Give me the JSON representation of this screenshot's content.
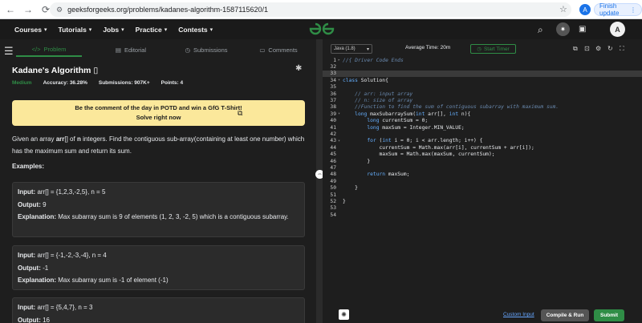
{
  "browser": {
    "url": "geeksforgeeks.org/problems/kadanes-algorithm-1587115620/1",
    "profile_letter": "A",
    "update_label": "Finish update"
  },
  "header": {
    "nav": [
      "Courses",
      "Tutorials",
      "Jobs",
      "Practice",
      "Contests"
    ],
    "logo": "GG",
    "user_letter": "A"
  },
  "tabs": [
    "Problem",
    "Editorial",
    "Submissions",
    "Comments"
  ],
  "problem": {
    "title": "Kadane's Algorithm",
    "difficulty": "Medium",
    "accuracy_label": "Accuracy:",
    "accuracy": "36.28%",
    "submissions_label": "Submissions:",
    "submissions": "907K+",
    "points_label": "Points:",
    "points": "4",
    "potd_line1": "Be the comment of the day in POTD and win a GfG T-Shirt!",
    "potd_line2": "Solve right now",
    "description_pre": "Given an array ",
    "description_arr": "arr",
    "description_mid": "[] of ",
    "description_n": "n",
    "description_post": " integers. Find the contiguous sub-array(containing at least one number) which has the maximum sum and return its sum.",
    "examples_heading": "Examples:",
    "examples": [
      {
        "input": "arr[] = {1,2,3,-2,5}, n = 5",
        "output": "9",
        "explanation": "Max subarray sum is 9 of elements (1, 2, 3, -2, 5) which is a contiguous subarray."
      },
      {
        "input": "arr[] = {-1,-2,-3,-4}, n = 4",
        "output": "-1",
        "explanation": "Max subarray sum is -1 of element (-1)"
      },
      {
        "input": "arr[] = {5,4,7}, n = 3",
        "output": "16"
      }
    ],
    "labels": {
      "input": "Input:",
      "output": "Output:",
      "explanation": "Explanation:"
    }
  },
  "editor": {
    "language": "Java (1.8)",
    "avg_time": "Average Time: 20m",
    "start_timer": "Start Timer",
    "lines": [
      {
        "n": "1",
        "t": "//{ Driver Code Ends",
        "c": "cm",
        "fold": "+"
      },
      {
        "n": "32",
        "t": ""
      },
      {
        "n": "33",
        "t": "",
        "hl": true
      },
      {
        "n": "34",
        "t": "class Solution{",
        "fold": "-"
      },
      {
        "n": "35",
        "t": ""
      },
      {
        "n": "36",
        "t": "    // arr: input array",
        "c": "cm"
      },
      {
        "n": "37",
        "t": "    // n: size of array",
        "c": "cm"
      },
      {
        "n": "38",
        "t": "    //Function to find the sum of contiguous subarray with maximum sum.",
        "c": "cm"
      },
      {
        "n": "39",
        "t": "    long maxSubarraySum(int arr[], int n){",
        "fold": "-"
      },
      {
        "n": "40",
        "t": "        long currentSum = 0;"
      },
      {
        "n": "41",
        "t": "        long maxSum = Integer.MIN_VALUE;"
      },
      {
        "n": "42",
        "t": ""
      },
      {
        "n": "43",
        "t": "        for (int i = 0; i < arr.length; i++) {",
        "fold": "-"
      },
      {
        "n": "44",
        "t": "            currentSum = Math.max(arr[i], currentSum + arr[i]);"
      },
      {
        "n": "45",
        "t": "            maxSum = Math.max(maxSum, currentSum);"
      },
      {
        "n": "46",
        "t": "        }"
      },
      {
        "n": "47",
        "t": ""
      },
      {
        "n": "48",
        "t": "        return maxSum;"
      },
      {
        "n": "49",
        "t": ""
      },
      {
        "n": "50",
        "t": "    }"
      },
      {
        "n": "51",
        "t": ""
      },
      {
        "n": "52",
        "t": "}"
      },
      {
        "n": "53",
        "t": ""
      },
      {
        "n": "54",
        "t": ""
      }
    ],
    "custom_input": "Custom Input",
    "compile": "Compile & Run",
    "submit": "Submit"
  }
}
